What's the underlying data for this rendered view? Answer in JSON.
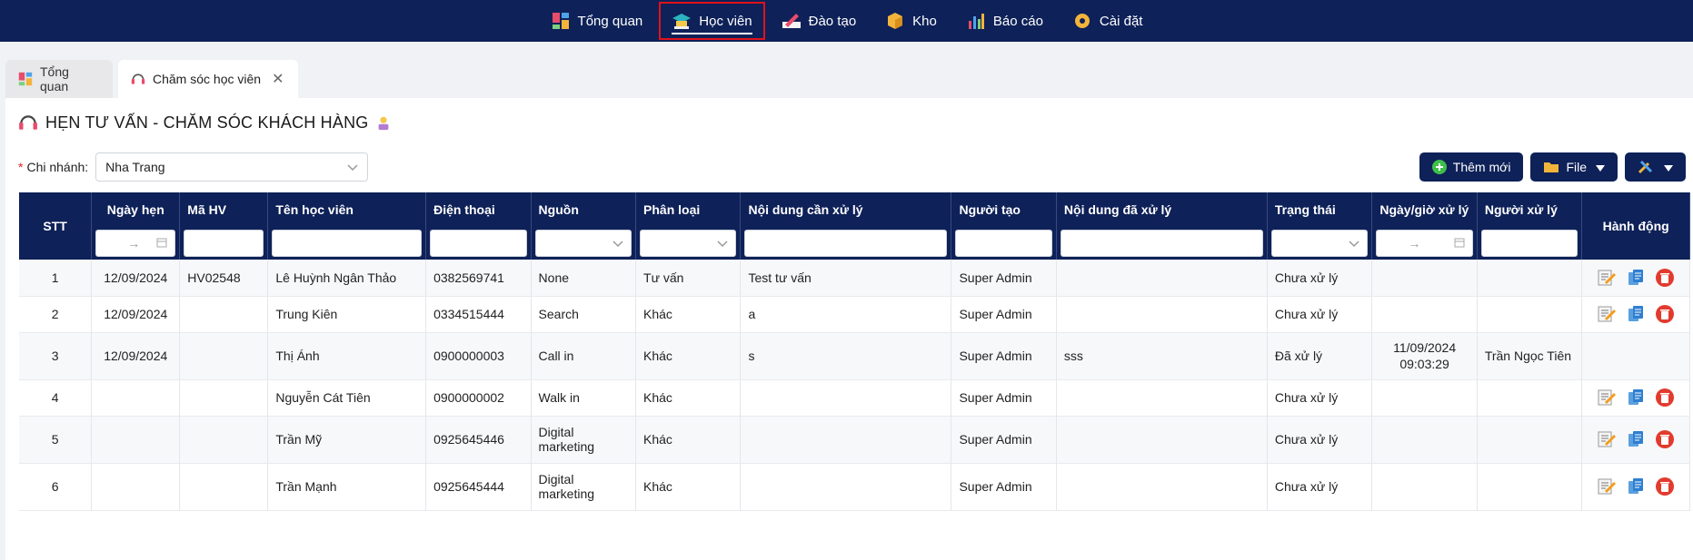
{
  "nav": [
    {
      "label": "Tổng quan",
      "icon": "dashboard-icon"
    },
    {
      "label": "Học viên",
      "icon": "graduation-cap-icon",
      "active": true
    },
    {
      "label": "Đào tạo",
      "icon": "pencil-book-icon"
    },
    {
      "label": "Kho",
      "icon": "box-icon"
    },
    {
      "label": "Báo cáo",
      "icon": "bar-chart-icon"
    },
    {
      "label": "Cài đặt",
      "icon": "gear-icon"
    }
  ],
  "tabs": {
    "overview": "Tổng quan",
    "care": "Chăm sóc học viên",
    "close": "✕"
  },
  "page": {
    "title": "HẸN TƯ VẤN - CHĂM SÓC KHÁCH HÀNG",
    "branch_label": "Chi nhánh:",
    "branch_value": "Nha Trang"
  },
  "buttons": {
    "add": "Thêm mới",
    "file": "File"
  },
  "table": {
    "headers": [
      "STT",
      "Ngày hẹn",
      "Mã HV",
      "Tên học viên",
      "Điện thoại",
      "Nguồn",
      "Phân loại",
      "Nội dung cần xử lý",
      "Người tạo",
      "Nội dung đã xử lý",
      "Trạng thái",
      "Ngày/giờ xử lý",
      "Người xử lý",
      "Hành động"
    ],
    "date_arrow": "→",
    "rows": [
      {
        "stt": "1",
        "date": "12/09/2024",
        "code": "HV02548",
        "name": "Lê Huỳnh Ngân Thảo",
        "phone": "0382569741",
        "source": "None",
        "type": "Tư vấn",
        "todo": "Test tư vấn",
        "creator": "Super Admin",
        "done": "",
        "status": "Chưa xử lý",
        "handled_at": "",
        "handler": "",
        "actions": true
      },
      {
        "stt": "2",
        "date": "12/09/2024",
        "code": "",
        "name": "Trung Kiên",
        "phone": "0334515444",
        "source": "Search",
        "type": "Khác",
        "todo": "a",
        "creator": "Super Admin",
        "done": "",
        "status": "Chưa xử lý",
        "handled_at": "",
        "handler": "",
        "actions": true
      },
      {
        "stt": "3",
        "date": "12/09/2024",
        "code": "",
        "name": "Thị Ánh",
        "phone": "0900000003",
        "source": "Call in",
        "type": "Khác",
        "todo": "s",
        "creator": "Super Admin",
        "done": "sss",
        "status": "Đã xử lý",
        "handled_at": "11/09/2024 09:03:29",
        "handler": "Trần Ngọc Tiên",
        "actions": false
      },
      {
        "stt": "4",
        "date": "",
        "code": "",
        "name": "Nguyễn Cát Tiên",
        "phone": "0900000002",
        "source": "Walk in",
        "type": "Khác",
        "todo": "",
        "creator": "Super Admin",
        "done": "",
        "status": "Chưa xử lý",
        "handled_at": "",
        "handler": "",
        "actions": true
      },
      {
        "stt": "5",
        "date": "",
        "code": "",
        "name": "Trần Mỹ",
        "phone": "0925645446",
        "source": "Digital marketing",
        "type": "Khác",
        "todo": "",
        "creator": "Super Admin",
        "done": "",
        "status": "Chưa xử lý",
        "handled_at": "",
        "handler": "",
        "actions": true
      },
      {
        "stt": "6",
        "date": "",
        "code": "",
        "name": "Trần Mạnh",
        "phone": "0925645444",
        "source": "Digital marketing",
        "type": "Khác",
        "todo": "",
        "creator": "Super Admin",
        "done": "",
        "status": "Chưa xử lý",
        "handled_at": "",
        "handler": "",
        "actions": true
      }
    ]
  },
  "colors": {
    "navy": "#0e2158",
    "active_outline": "#e0121c",
    "required": "#e02424",
    "delete": "#e23b2e",
    "copy": "#2f7fd1"
  }
}
